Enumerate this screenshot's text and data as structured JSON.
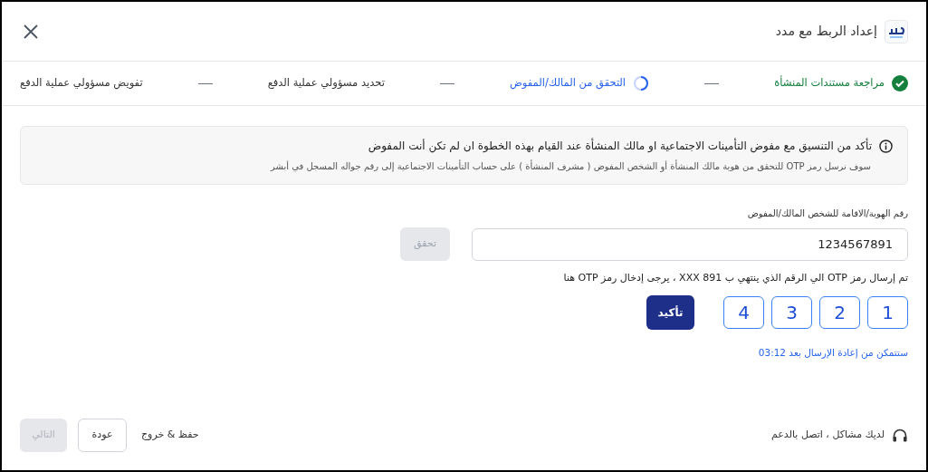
{
  "header": {
    "title": "إعداد الربط مع مدد"
  },
  "steps": [
    {
      "label": "مراجعة مستندات المنشأة",
      "kind": "done"
    },
    {
      "label": "التحقق من المالك/المفوض",
      "kind": "current"
    },
    {
      "label": "تحديد مسؤولي عملية الدفع",
      "kind": "pending"
    },
    {
      "label": "تفويض مسؤولي عملية الدفع",
      "kind": "pending"
    }
  ],
  "notice": {
    "title": "تأكد من التنسيق مع مفوض التأمينات الاجتماعية او مالك المنشأة عند القيام بهذه الخطوة ان لم تكن أنت المفوض",
    "body": "سوف نرسل رمز OTP للتحقق من هوية مالك المنشأة أو الشخص المفوض ( مشرف المنشأة ) على حساب التأمينات الاجتماعية إلى رقم جواله المسجل في أبشر"
  },
  "id_field": {
    "label": "رقم الهوية/الاقامة للشخص المالك/المفوض",
    "value": "1234567891"
  },
  "verify_button": {
    "label": "تحقق",
    "disabled": true
  },
  "otp_message": "تم إرسال رمز OTP الي الرقم الذي ينتهي ب XXX 891 ، يرجى إدخال رمز OTP هنا",
  "otp_digits": [
    "1",
    "2",
    "3",
    "4"
  ],
  "confirm_button": {
    "label": "تأكيد",
    "disabled": false
  },
  "resend_text": "ستتمكن من إعادة الإرسال بعد 03:12",
  "footer": {
    "support": "لديك مشاكل ، اتصل بالدعم",
    "save_exit": "حفظ & خروج",
    "back": "عودة",
    "next": {
      "label": "التالي",
      "disabled": true
    }
  }
}
